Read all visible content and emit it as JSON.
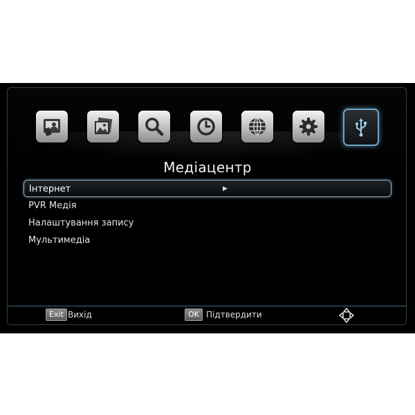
{
  "toolbar": {
    "icons": [
      {
        "name": "tv-icon"
      },
      {
        "name": "photo-icon"
      },
      {
        "name": "search-icon"
      },
      {
        "name": "clock-icon"
      },
      {
        "name": "globe-icon"
      },
      {
        "name": "gear-icon"
      },
      {
        "name": "usb-icon",
        "active": true
      }
    ]
  },
  "page": {
    "title": "Медіацентр"
  },
  "menu": {
    "items": [
      {
        "label": "Інтернет",
        "selected": true,
        "has_submenu": true
      },
      {
        "label": "PVR Медія"
      },
      {
        "label": "Налаштування запису"
      },
      {
        "label": "Мультимедіа"
      }
    ]
  },
  "footer": {
    "exit_key": "Exit",
    "exit_label": "Вихід",
    "ok_key": "OK",
    "ok_label": "Підтвердити",
    "nav_icon": "navigation-arrows-icon"
  },
  "colors": {
    "accent": "#6fa7c9",
    "background": "#000000",
    "text": "#e6e6e6"
  }
}
